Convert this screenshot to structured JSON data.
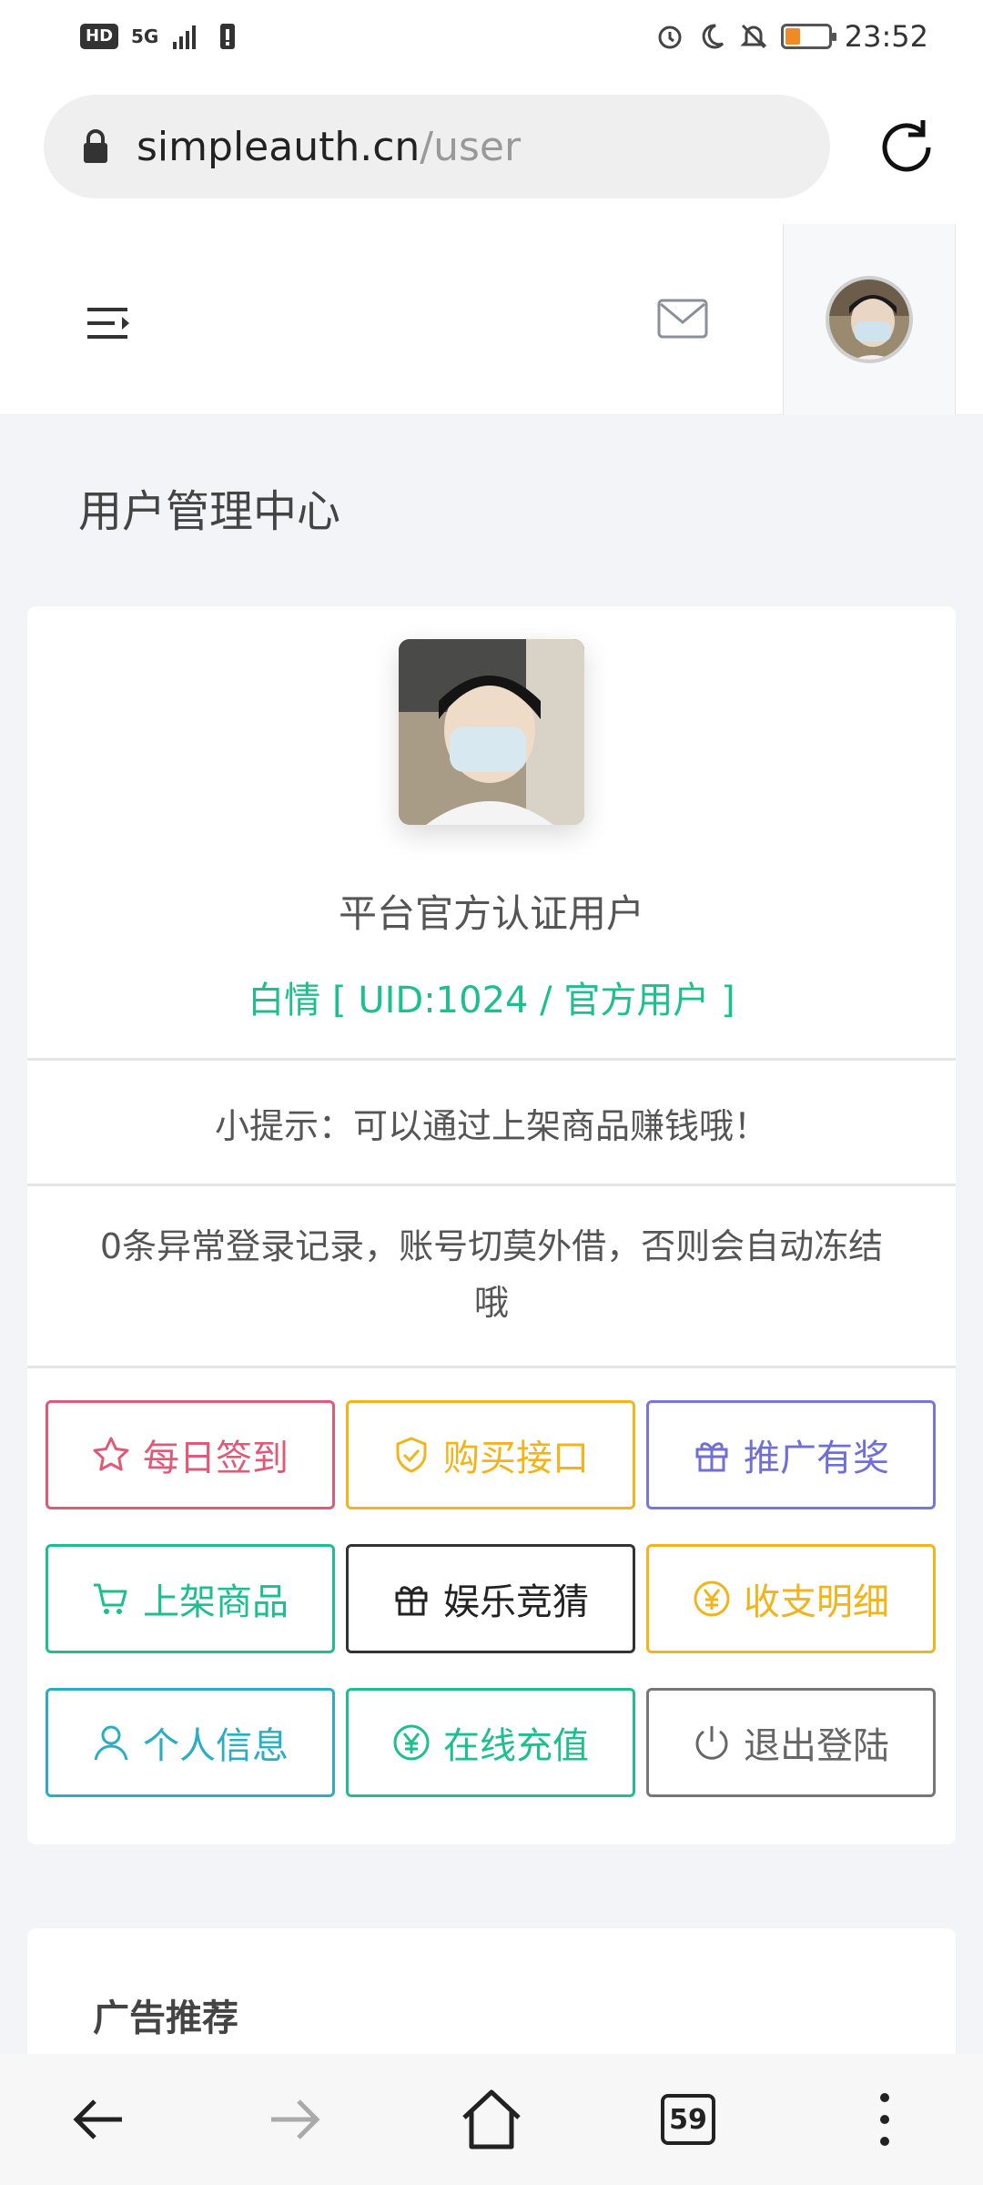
{
  "status_bar": {
    "badge": "HD",
    "network": "5G",
    "time": "23:52",
    "battery_percent": 25,
    "battery_color": "#f08a24"
  },
  "browser": {
    "url_host": "simpleauth.cn",
    "url_path": "/user",
    "lock_icon": "lock-icon",
    "reload_icon": "reload-icon"
  },
  "header": {
    "menu_icon": "menu-icon",
    "mail_icon": "mail-icon"
  },
  "page": {
    "title": "用户管理中心"
  },
  "profile": {
    "title": "平台官方认证用户",
    "subtitle": "白情 [ UID:1024 / 官方用户 ]",
    "tip": "小提示：可以通过上架商品赚钱哦！",
    "warning": "0条异常登录记录，账号切莫外借，否则会自动冻结哦"
  },
  "actions": [
    {
      "label": "每日签到",
      "icon": "star-icon",
      "color": "#e05a78"
    },
    {
      "label": "购买接口",
      "icon": "shield-check-icon",
      "color": "#f2b41a"
    },
    {
      "label": "推广有奖",
      "icon": "gift-icon",
      "color": "#6f6fd6"
    },
    {
      "label": "上架商品",
      "icon": "cart-icon",
      "color": "#1dbf8e"
    },
    {
      "label": "娱乐竞猜",
      "icon": "gift-icon",
      "color": "#222222"
    },
    {
      "label": "收支明细",
      "icon": "yen-circle-icon",
      "color": "#f2b41a"
    },
    {
      "label": "个人信息",
      "icon": "user-icon",
      "color": "#2aaec4"
    },
    {
      "label": "在线充值",
      "icon": "yen-circle-icon",
      "color": "#1dbf8e"
    },
    {
      "label": "退出登陆",
      "icon": "power-icon",
      "color": "#666666"
    }
  ],
  "ad": {
    "title": "广告推荐"
  },
  "bottom_nav": {
    "tab_count": "59",
    "icons": [
      "back-icon",
      "forward-icon",
      "home-icon",
      "tabs-icon",
      "more-icon"
    ]
  }
}
